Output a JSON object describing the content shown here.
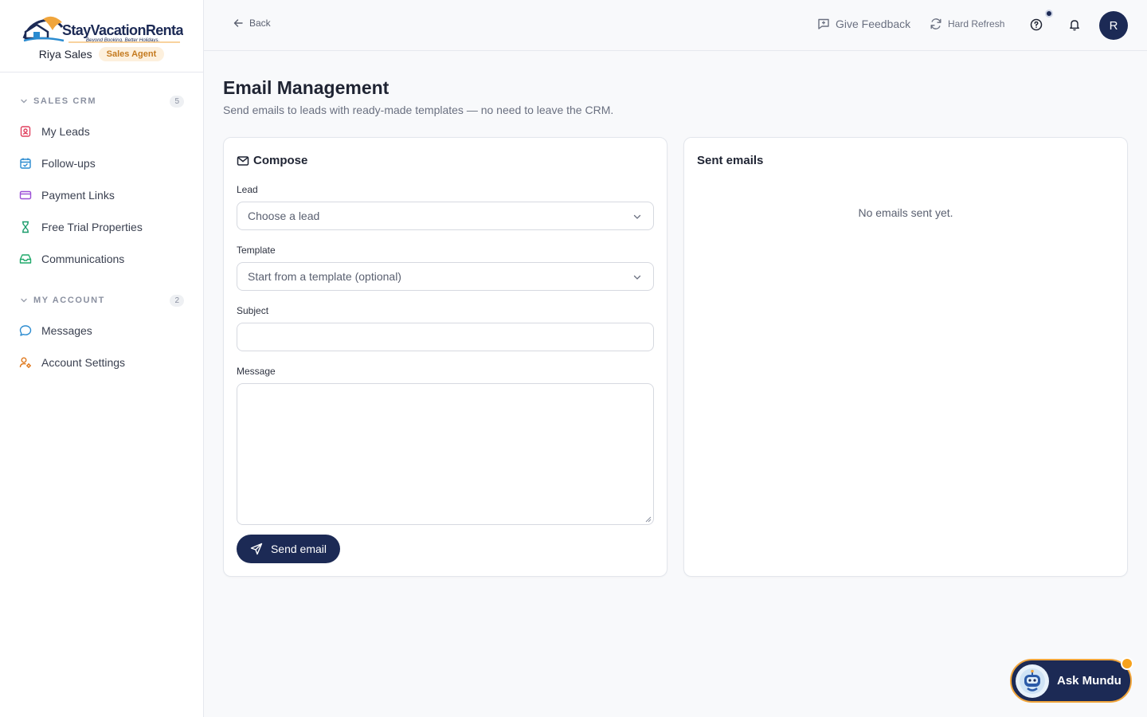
{
  "brand": {
    "logo_text": "StayVacationRentals",
    "logo_tagline": "Beyond Booking. Better Holidays.",
    "user_name": "Riya Sales",
    "role": "Sales Agent"
  },
  "sidebar": {
    "sections": [
      {
        "title": "SALES CRM",
        "count": "5",
        "items": [
          {
            "label": "My Leads",
            "icon": "contact-card-icon",
            "color": "#e0405e"
          },
          {
            "label": "Follow-ups",
            "icon": "calendar-check-icon",
            "color": "#2a8bd0"
          },
          {
            "label": "Payment Links",
            "icon": "credit-card-icon",
            "color": "#9b4fd6"
          },
          {
            "label": "Free Trial Properties",
            "icon": "hourglass-icon",
            "color": "#1a9c6b"
          },
          {
            "label": "Communications",
            "icon": "inbox-icon",
            "color": "#1fa86a"
          }
        ]
      },
      {
        "title": "MY ACCOUNT",
        "count": "2",
        "items": [
          {
            "label": "Messages",
            "icon": "chat-bubble-icon",
            "color": "#2a8bd0"
          },
          {
            "label": "Account Settings",
            "icon": "user-cog-icon",
            "color": "#e07a1f"
          }
        ]
      }
    ]
  },
  "topbar": {
    "back_label": "Back",
    "feedback_label": "Give Feedback",
    "refresh_label": "Hard Refresh",
    "avatar_initial": "R"
  },
  "page": {
    "title": "Email Management",
    "subtitle": "Send emails to leads with ready-made templates — no need to leave the CRM."
  },
  "compose": {
    "title": "Compose",
    "lead_label": "Lead",
    "lead_placeholder": "Choose a lead",
    "template_label": "Template",
    "template_placeholder": "Start from a template (optional)",
    "subject_label": "Subject",
    "subject_value": "",
    "message_label": "Message",
    "message_value": "",
    "send_label": "Send email"
  },
  "sent": {
    "title": "Sent emails",
    "empty_text": "No emails sent yet."
  },
  "assistant": {
    "label": "Ask Mundu"
  },
  "colors": {
    "primary": "#1c2a55",
    "accent_orange": "#f0a53c",
    "role_badge_text": "#c47a1f",
    "role_badge_bg": "#fdf0dd"
  }
}
